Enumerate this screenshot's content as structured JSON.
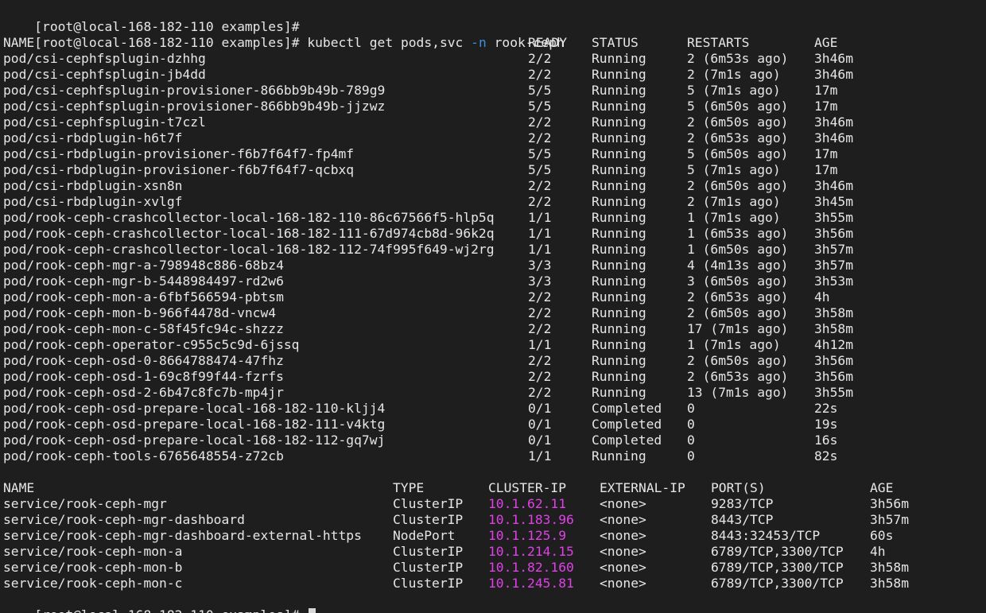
{
  "terminal": {
    "prompt": "[root@local-168-182-110 examples]#",
    "command": {
      "text_before_flag": "kubectl get pods,svc ",
      "flag": "-n",
      "text_after_flag": " rook-ceph"
    },
    "pods": {
      "headers": [
        "NAME",
        "READY",
        "STATUS",
        "RESTARTS",
        "AGE"
      ],
      "rows": [
        [
          "pod/csi-cephfsplugin-dzhhg",
          "2/2",
          "Running",
          "2 (6m53s ago)",
          "3h46m"
        ],
        [
          "pod/csi-cephfsplugin-jb4dd",
          "2/2",
          "Running",
          "2 (7m1s ago)",
          "3h46m"
        ],
        [
          "pod/csi-cephfsplugin-provisioner-866bb9b49b-789g9",
          "5/5",
          "Running",
          "5 (7m1s ago)",
          "17m"
        ],
        [
          "pod/csi-cephfsplugin-provisioner-866bb9b49b-jjzwz",
          "5/5",
          "Running",
          "5 (6m50s ago)",
          "17m"
        ],
        [
          "pod/csi-cephfsplugin-t7czl",
          "2/2",
          "Running",
          "2 (6m50s ago)",
          "3h46m"
        ],
        [
          "pod/csi-rbdplugin-h6t7f",
          "2/2",
          "Running",
          "2 (6m53s ago)",
          "3h46m"
        ],
        [
          "pod/csi-rbdplugin-provisioner-f6b7f64f7-fp4mf",
          "5/5",
          "Running",
          "5 (6m50s ago)",
          "17m"
        ],
        [
          "pod/csi-rbdplugin-provisioner-f6b7f64f7-qcbxq",
          "5/5",
          "Running",
          "5 (7m1s ago)",
          "17m"
        ],
        [
          "pod/csi-rbdplugin-xsn8n",
          "2/2",
          "Running",
          "2 (6m50s ago)",
          "3h46m"
        ],
        [
          "pod/csi-rbdplugin-xvlgf",
          "2/2",
          "Running",
          "2 (7m1s ago)",
          "3h45m"
        ],
        [
          "pod/rook-ceph-crashcollector-local-168-182-110-86c67566f5-hlp5q",
          "1/1",
          "Running",
          "1 (7m1s ago)",
          "3h55m"
        ],
        [
          "pod/rook-ceph-crashcollector-local-168-182-111-67d974cb8d-96k2q",
          "1/1",
          "Running",
          "1 (6m53s ago)",
          "3h56m"
        ],
        [
          "pod/rook-ceph-crashcollector-local-168-182-112-74f995f649-wj2rg",
          "1/1",
          "Running",
          "1 (6m50s ago)",
          "3h57m"
        ],
        [
          "pod/rook-ceph-mgr-a-798948c886-68bz4",
          "3/3",
          "Running",
          "4 (4m13s ago)",
          "3h57m"
        ],
        [
          "pod/rook-ceph-mgr-b-5448984497-rd2w6",
          "3/3",
          "Running",
          "3 (6m50s ago)",
          "3h53m"
        ],
        [
          "pod/rook-ceph-mon-a-6fbf566594-pbtsm",
          "2/2",
          "Running",
          "2 (6m53s ago)",
          "4h"
        ],
        [
          "pod/rook-ceph-mon-b-966f4478d-vncw4",
          "2/2",
          "Running",
          "2 (6m50s ago)",
          "3h58m"
        ],
        [
          "pod/rook-ceph-mon-c-58f45fc94c-shzzz",
          "2/2",
          "Running",
          "17 (7m1s ago)",
          "3h58m"
        ],
        [
          "pod/rook-ceph-operator-c955c5c9d-6jssq",
          "1/1",
          "Running",
          "1 (7m1s ago)",
          "4h12m"
        ],
        [
          "pod/rook-ceph-osd-0-8664788474-47fhz",
          "2/2",
          "Running",
          "2 (6m50s ago)",
          "3h56m"
        ],
        [
          "pod/rook-ceph-osd-1-69c8f99f44-fzrfs",
          "2/2",
          "Running",
          "2 (6m53s ago)",
          "3h56m"
        ],
        [
          "pod/rook-ceph-osd-2-6b47c8fc7b-mp4jr",
          "2/2",
          "Running",
          "13 (7m1s ago)",
          "3h55m"
        ],
        [
          "pod/rook-ceph-osd-prepare-local-168-182-110-kljj4",
          "0/1",
          "Completed",
          "0",
          "22s"
        ],
        [
          "pod/rook-ceph-osd-prepare-local-168-182-111-v4ktg",
          "0/1",
          "Completed",
          "0",
          "19s"
        ],
        [
          "pod/rook-ceph-osd-prepare-local-168-182-112-gq7wj",
          "0/1",
          "Completed",
          "0",
          "16s"
        ],
        [
          "pod/rook-ceph-tools-6765648554-z72cb",
          "1/1",
          "Running",
          "0",
          "82s"
        ]
      ]
    },
    "services": {
      "headers": [
        "NAME",
        "TYPE",
        "CLUSTER-IP",
        "EXTERNAL-IP",
        "PORT(S)",
        "AGE"
      ],
      "rows": [
        [
          "service/rook-ceph-mgr",
          "ClusterIP",
          "10.1.62.11",
          "<none>",
          "9283/TCP",
          "3h56m"
        ],
        [
          "service/rook-ceph-mgr-dashboard",
          "ClusterIP",
          "10.1.183.96",
          "<none>",
          "8443/TCP",
          "3h57m"
        ],
        [
          "service/rook-ceph-mgr-dashboard-external-https",
          "NodePort",
          "10.1.125.9",
          "<none>",
          "8443:32453/TCP",
          "60s"
        ],
        [
          "service/rook-ceph-mon-a",
          "ClusterIP",
          "10.1.214.15",
          "<none>",
          "6789/TCP,3300/TCP",
          "4h"
        ],
        [
          "service/rook-ceph-mon-b",
          "ClusterIP",
          "10.1.82.160",
          "<none>",
          "6789/TCP,3300/TCP",
          "3h58m"
        ],
        [
          "service/rook-ceph-mon-c",
          "ClusterIP",
          "10.1.245.81",
          "<none>",
          "6789/TCP,3300/TCP",
          "3h58m"
        ]
      ]
    },
    "colors": {
      "background": "#1e1e1e",
      "foreground": "#e6e6e6",
      "flag": "#3f8fe0",
      "ip": "#e040e8"
    }
  }
}
